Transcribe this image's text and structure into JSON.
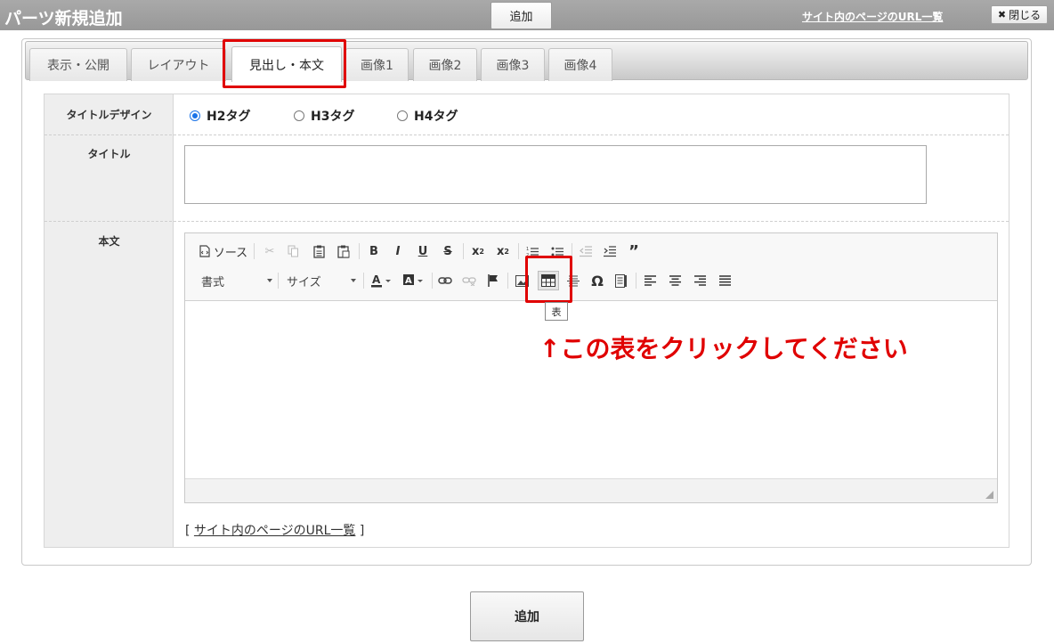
{
  "header": {
    "title": "パーツ新規追加",
    "add_label": "追加",
    "url_list_label": "サイト内のページのURL一覧",
    "close_label": "閉じる"
  },
  "tabs": [
    {
      "label": "表示・公開"
    },
    {
      "label": "レイアウト"
    },
    {
      "label": "見出し・本文",
      "active": true
    },
    {
      "label": "画像1"
    },
    {
      "label": "画像2"
    },
    {
      "label": "画像3"
    },
    {
      "label": "画像4"
    }
  ],
  "form": {
    "title_design": {
      "label": "タイトルデザイン",
      "options": [
        "H2タグ",
        "H3タグ",
        "H4タグ"
      ],
      "selected": "H2タグ"
    },
    "title": {
      "label": "タイトル",
      "value": ""
    },
    "body": {
      "label": "本文"
    }
  },
  "editor": {
    "source_label": "ソース",
    "format_label": "書式",
    "size_label": "サイズ",
    "table_tooltip": "表",
    "content": ""
  },
  "annotation": "↑この表をクリックしてください",
  "site_link": {
    "open_bracket": "[",
    "label": "サイト内のページのURL一覧",
    "close_bracket": "]"
  },
  "footer": {
    "add_label": "追加"
  },
  "colors": {
    "highlight": "#e00000",
    "header_bg": "#a0a0a0",
    "radio_accent": "#1a73e8"
  }
}
